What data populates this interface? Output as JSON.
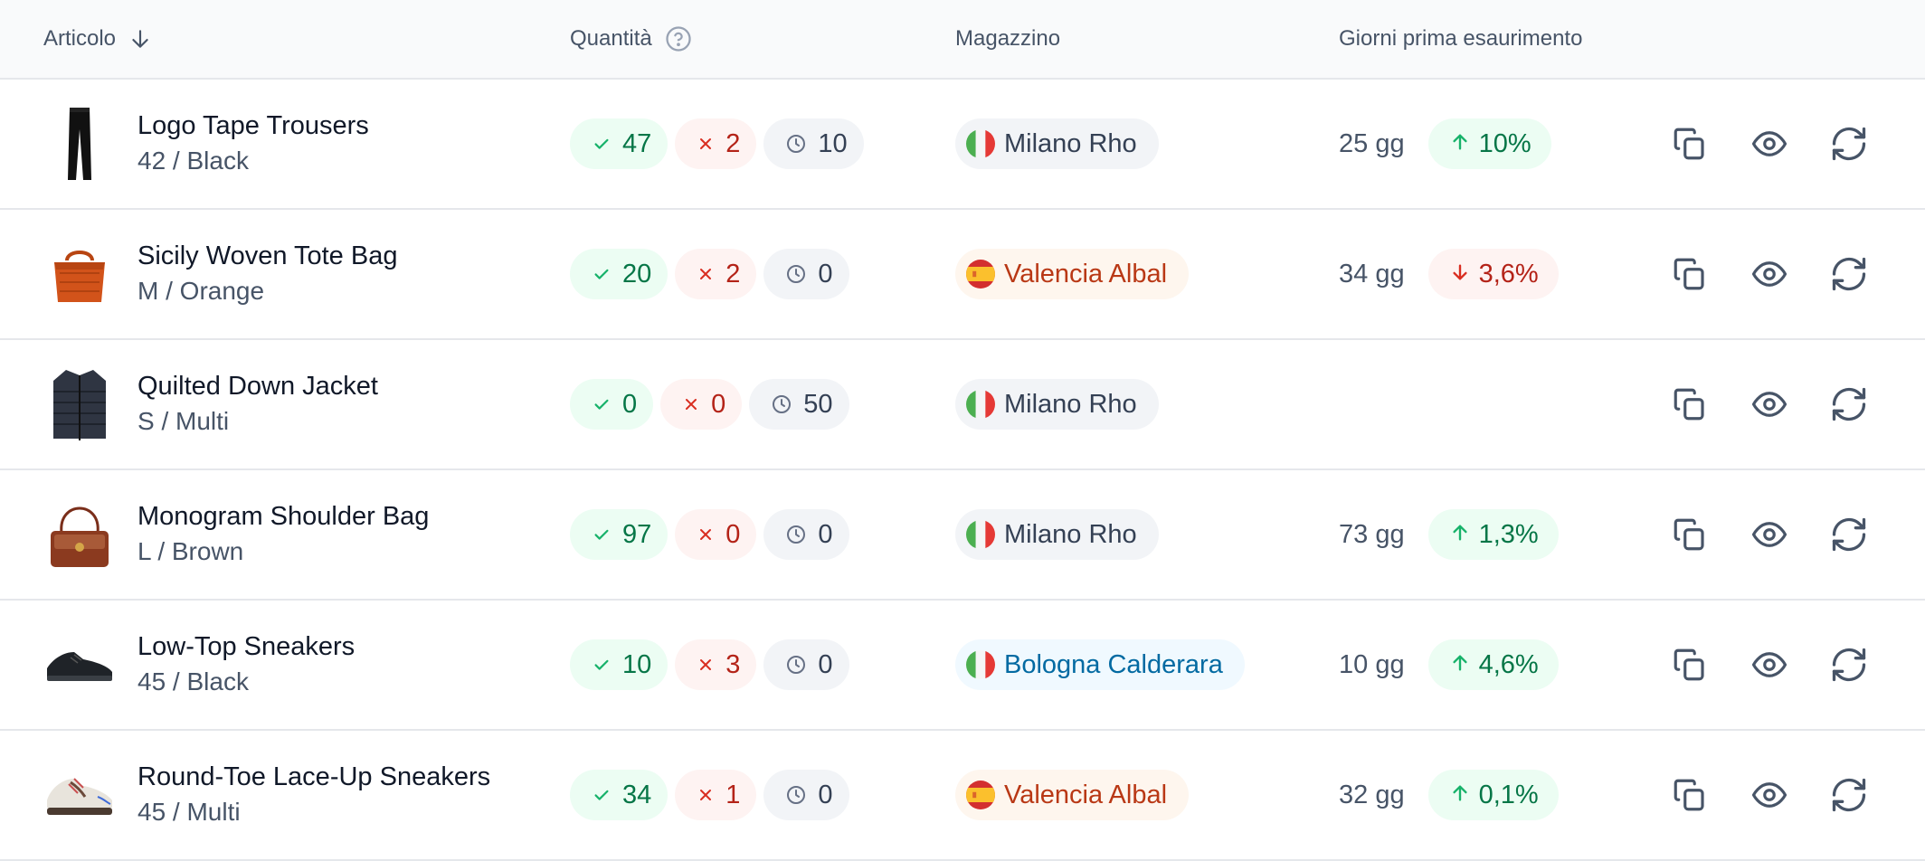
{
  "header": {
    "article": "Articolo",
    "quantity": "Quantità",
    "warehouse": "Magazzino",
    "days": "Giorni prima esaurimento"
  },
  "colors": {
    "ok_bg": "#ecfdf3",
    "ok_fg": "#067647",
    "ko_bg": "#fef3f2",
    "ko_fg": "#b42318",
    "neutral_bg": "#f2f4f7",
    "neutral_fg": "#344054",
    "orange_bg": "#fef6ee",
    "orange_fg": "#b93815",
    "blue_bg": "#f0f9ff",
    "blue_fg": "#026aa2"
  },
  "rows": [
    {
      "name": "Logo Tape Trousers",
      "variant": "42 / Black",
      "image": "trousers-image",
      "available": "47",
      "unavailable": "2",
      "pending": "10",
      "warehouse": "Milano Rho",
      "flag": "italy-flag",
      "warehouse_style": "gray",
      "days": "25 gg",
      "trend": "10%",
      "trend_dir": "up"
    },
    {
      "name": "Sicily Woven Tote Bag",
      "variant": "M / Orange",
      "image": "tote-bag-image",
      "available": "20",
      "unavailable": "2",
      "pending": "0",
      "warehouse": "Valencia Albal",
      "flag": "spain-flag",
      "warehouse_style": "orange",
      "days": "34 gg",
      "trend": "3,6%",
      "trend_dir": "down"
    },
    {
      "name": "Quilted Down Jacket",
      "variant": "S / Multi",
      "image": "jacket-image",
      "available": "0",
      "unavailable": "0",
      "pending": "50",
      "warehouse": "Milano Rho",
      "flag": "italy-flag",
      "warehouse_style": "gray",
      "days": "",
      "trend": "",
      "trend_dir": ""
    },
    {
      "name": "Monogram Shoulder Bag",
      "variant": "L / Brown",
      "image": "shoulder-bag-image",
      "available": "97",
      "unavailable": "0",
      "pending": "0",
      "warehouse": "Milano Rho",
      "flag": "italy-flag",
      "warehouse_style": "gray",
      "days": "73 gg",
      "trend": "1,3%",
      "trend_dir": "up"
    },
    {
      "name": "Low-Top Sneakers",
      "variant": "45 / Black",
      "image": "sneakers-image",
      "available": "10",
      "unavailable": "3",
      "pending": "0",
      "warehouse": "Bologna Calderara",
      "flag": "italy-flag",
      "warehouse_style": "blue",
      "days": "10 gg",
      "trend": "4,6%",
      "trend_dir": "up"
    },
    {
      "name": "Round-Toe Lace-Up Sneakers",
      "variant": "45 / Multi",
      "image": "lace-up-sneakers-image",
      "available": "34",
      "unavailable": "1",
      "pending": "0",
      "warehouse": "Valencia Albal",
      "flag": "spain-flag",
      "warehouse_style": "orange",
      "days": "32 gg",
      "trend": "0,1%",
      "trend_dir": "up"
    }
  ],
  "icons": {
    "sort": "arrow-down-icon",
    "help": "help-circle-icon",
    "available": "check-icon",
    "unavailable": "x-icon",
    "pending": "clock-icon",
    "trend_up": "arrow-up-icon",
    "trend_down": "arrow-down-icon",
    "copy": "copy-icon",
    "view": "eye-icon",
    "refresh": "refresh-icon"
  }
}
